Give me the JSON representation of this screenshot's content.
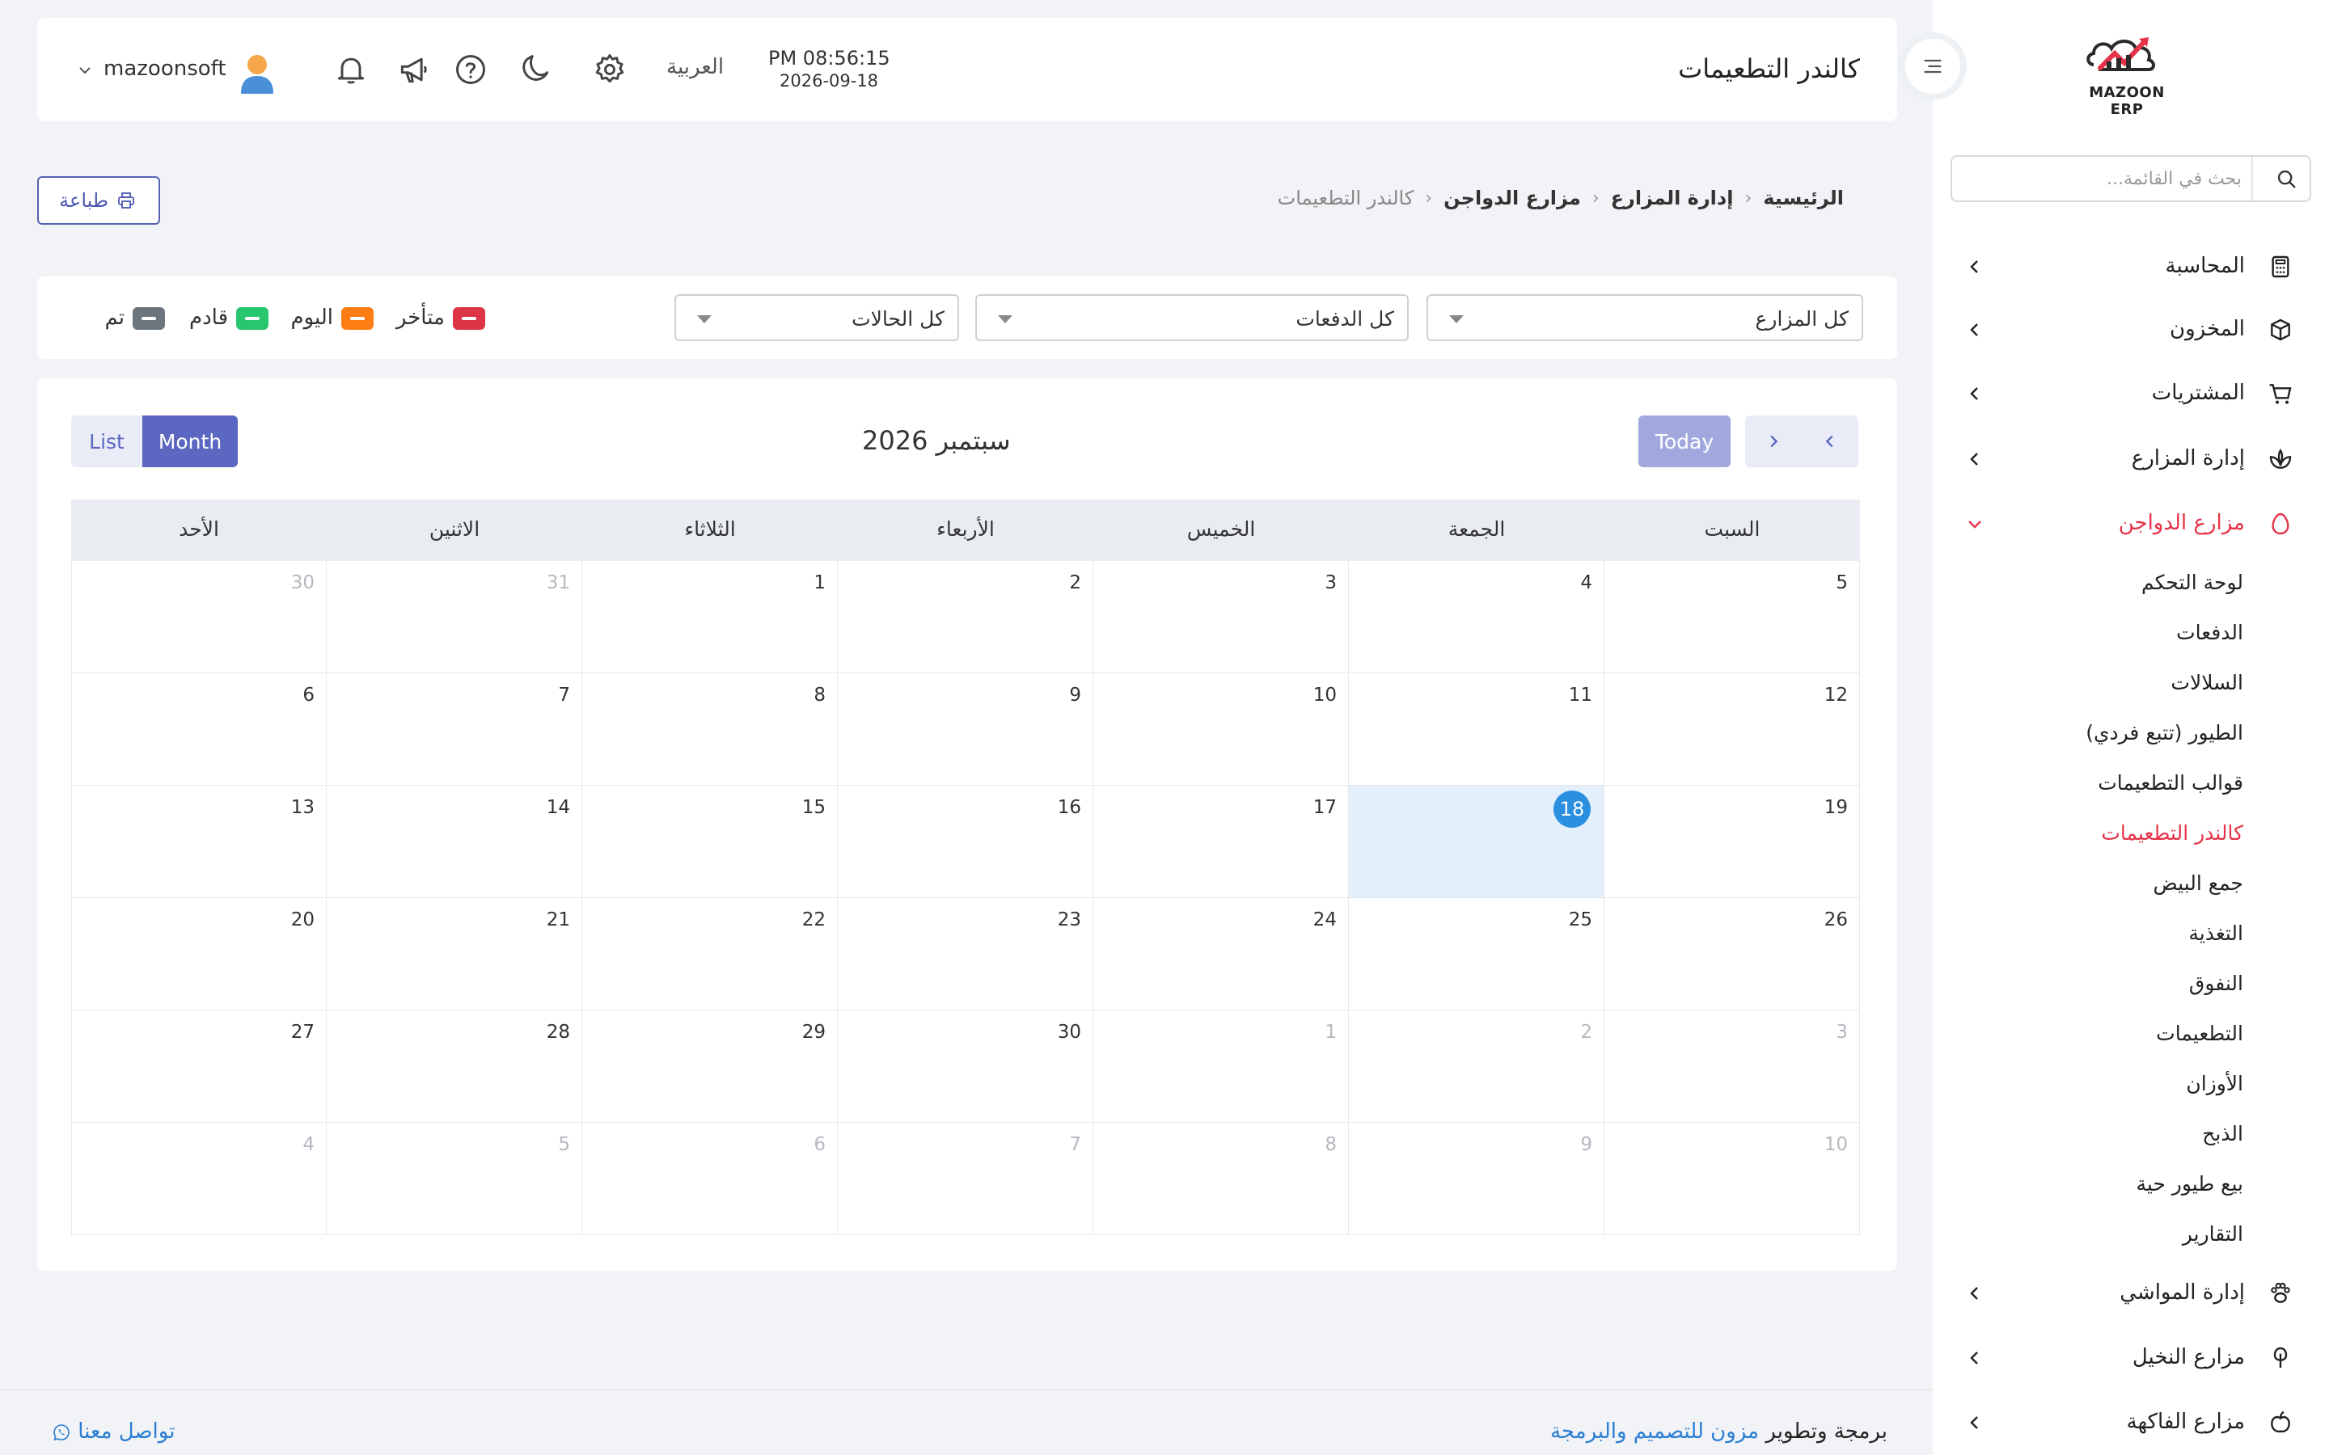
{
  "app": {
    "logo_text": "MAZOON ERP",
    "logo_small": "ERP.ERP"
  },
  "header": {
    "title": "كالندر التطعيمات",
    "time": "PM 08:56:15",
    "date": "2026-09-18",
    "language": "العربية",
    "username": "mazoonsoft",
    "icons": [
      "gear-icon",
      "moon-icon",
      "help-icon",
      "megaphone-icon",
      "bell-icon"
    ]
  },
  "sidebar": {
    "search_placeholder": "بحث في القائمة...",
    "items": [
      {
        "label": "المحاسبة",
        "icon": "calculator-icon"
      },
      {
        "label": "المخزون",
        "icon": "box-icon"
      },
      {
        "label": "المشتريات",
        "icon": "cart-icon"
      },
      {
        "label": "إدارة المزارع",
        "icon": "plant-icon"
      },
      {
        "label": "مزارع الدواجن",
        "icon": "egg-icon",
        "active": true
      },
      {
        "label": "إدارة المواشي",
        "icon": "paw-icon"
      },
      {
        "label": "مزارع النخيل",
        "icon": "palm-icon"
      },
      {
        "label": "مزارع الفاكهة",
        "icon": "apple-icon"
      }
    ],
    "sub_items": [
      "لوحة التحكم",
      "الدفعات",
      "السلالات",
      "الطيور (تتبع فردي)",
      "قوالب التطعيمات",
      "كالندر التطعيمات",
      "جمع البيض",
      "التغذية",
      "النفوق",
      "التطعيمات",
      "الأوزان",
      "الذبح",
      "بيع طيور حية",
      "التقارير"
    ],
    "active_sub": 5
  },
  "breadcrumb": [
    "الرئيسية",
    "إدارة المزارع",
    "مزارع الدواجن",
    "كالندر التطعيمات"
  ],
  "print_label": "طباعة",
  "filters": {
    "farm": "كل المزارع",
    "batch": "كل الدفعات",
    "status": "كل الحالات"
  },
  "legend": [
    {
      "label": "متأخر",
      "color": "#dc3545"
    },
    {
      "label": "اليوم",
      "color": "#fd7e14"
    },
    {
      "label": "قادم",
      "color": "#28c76f"
    },
    {
      "label": "تم",
      "color": "#6c757d"
    }
  ],
  "calendar": {
    "title": "سبتمبر 2026",
    "today_label": "Today",
    "month_label": "Month",
    "list_label": "List",
    "weekdays": [
      "السبت",
      "الجمعة",
      "الخميس",
      "الأربعاء",
      "الثلاثاء",
      "الاثنين",
      "الأحد"
    ],
    "weeks": [
      [
        5,
        4,
        3,
        2,
        1,
        31,
        30
      ],
      [
        12,
        11,
        10,
        9,
        8,
        7,
        6
      ],
      [
        19,
        18,
        17,
        16,
        15,
        14,
        13
      ],
      [
        26,
        25,
        24,
        23,
        22,
        21,
        20
      ],
      [
        3,
        2,
        1,
        30,
        29,
        28,
        27
      ],
      [
        10,
        9,
        8,
        7,
        6,
        5,
        4
      ]
    ],
    "other_month": [
      [
        false,
        false,
        false,
        false,
        false,
        true,
        true
      ],
      [
        false,
        false,
        false,
        false,
        false,
        false,
        false
      ],
      [
        false,
        false,
        false,
        false,
        false,
        false,
        false
      ],
      [
        false,
        false,
        false,
        false,
        false,
        false,
        false
      ],
      [
        true,
        true,
        true,
        false,
        false,
        false,
        false
      ],
      [
        true,
        true,
        true,
        true,
        true,
        true,
        true
      ]
    ],
    "today": 18
  },
  "footer": {
    "credit_prefix": "برمجة وتطوير",
    "company": "مزون للتصميم والبرمجة",
    "contact": "تواصل معنا"
  }
}
